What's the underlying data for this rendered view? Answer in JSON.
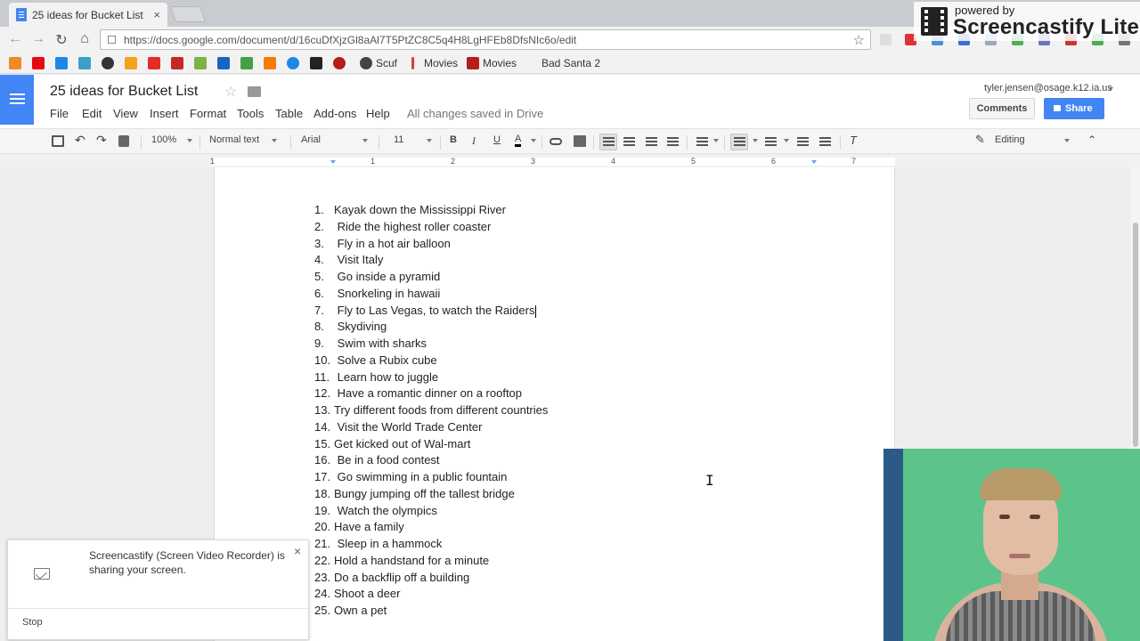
{
  "browser": {
    "tab": {
      "title": "25 ideas for Bucket List",
      "close": "×"
    },
    "nav": {
      "back": "←",
      "forward": "→",
      "reload": "↻",
      "home": "⌂"
    },
    "url": "https://docs.google.com/document/d/16cuDfXjzGl8aAl7T5PtZC8C5q4H8LgHFEb8DfsNIc6o/edit",
    "star": "☆",
    "bookmarks": [
      {
        "label": "Scuf"
      },
      {
        "label": "Movies"
      },
      {
        "label": "Movies"
      },
      {
        "label": "Bad Santa 2"
      }
    ]
  },
  "watermark": {
    "line1": "powered by",
    "line2": "Screencastify Lite"
  },
  "docs": {
    "title": "25 ideas for Bucket List",
    "title_star": "☆",
    "menu": [
      "File",
      "Edit",
      "View",
      "Insert",
      "Format",
      "Tools",
      "Table",
      "Add-ons",
      "Help"
    ],
    "save_status": "All changes saved in Drive",
    "user_email": "tyler.jensen@osage.k12.ia.us",
    "comments_label": "Comments",
    "share_label": "Share"
  },
  "toolbar": {
    "zoom": "100%",
    "style": "Normal text",
    "font": "Arial",
    "size": "11",
    "bold": "B",
    "italic": "I",
    "underline": "U",
    "text_color": "A",
    "mode": "Editing"
  },
  "ruler": {
    "labels": [
      "1",
      "1",
      "2",
      "3",
      "4",
      "5",
      "6",
      "7"
    ]
  },
  "document": {
    "items": [
      {
        "num": "1.",
        "text": "Kayak down the Mississippi River"
      },
      {
        "num": "2.",
        "text": "Ride the highest roller coaster"
      },
      {
        "num": "3.",
        "text": "Fly in a hot air balloon"
      },
      {
        "num": "4.",
        "text": "Visit Italy"
      },
      {
        "num": "5.",
        "text": "Go inside a pyramid"
      },
      {
        "num": "6.",
        "text": "Snorkeling in hawaii"
      },
      {
        "num": "7.",
        "text": "Fly to Las Vegas, to watch the Raiders"
      },
      {
        "num": "8.",
        "text": "Skydiving"
      },
      {
        "num": "9.",
        "text": "Swim with sharks"
      },
      {
        "num": "10.",
        "text": "Solve a Rubix cube"
      },
      {
        "num": "11.",
        "text": "Learn how to juggle"
      },
      {
        "num": "12.",
        "text": "Have a romantic dinner on a rooftop"
      },
      {
        "num": "13.",
        "text": "Try different foods from different countries"
      },
      {
        "num": "14.",
        "text": "Visit the World Trade Center"
      },
      {
        "num": "15.",
        "text": "Get kicked out of Wal-mart"
      },
      {
        "num": "16.",
        "text": "Be in a food contest"
      },
      {
        "num": "17.",
        "text": "Go swimming in a public fountain"
      },
      {
        "num": "18.",
        "text": "Bungy jumping off the tallest bridge"
      },
      {
        "num": "19.",
        "text": "Watch the olympics"
      },
      {
        "num": "20.",
        "text": "Have a family"
      },
      {
        "num": "21.",
        "text": "Sleep in a hammock"
      },
      {
        "num": "22.",
        "text": "Hold a handstand for a minute"
      },
      {
        "num": "23.",
        "text": "Do a backflip off a building"
      },
      {
        "num": "24.",
        "text": "Shoot a deer"
      },
      {
        "num": "25.",
        "text": "Own a pet"
      }
    ]
  },
  "notification": {
    "message": "Screencastify (Screen Video Recorder) is sharing your screen.",
    "close": "×",
    "stop_label": "Stop"
  },
  "colors": {
    "docs_blue": "#4285f4",
    "webcam_background": "#5cc48a"
  }
}
